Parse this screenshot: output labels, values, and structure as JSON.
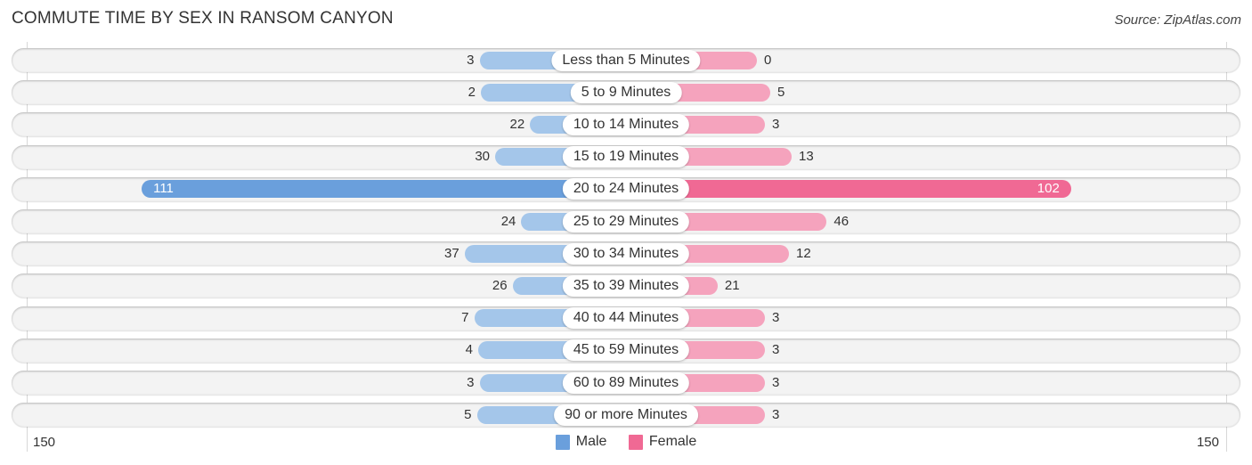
{
  "title": "COMMUTE TIME BY SEX IN RANSOM CANYON",
  "source": "Source: ZipAtlas.com",
  "chart_data": {
    "type": "bar",
    "orientation": "horizontal-diverging",
    "title": "COMMUTE TIME BY SEX IN RANSOM CANYON",
    "categories": [
      "Less than 5 Minutes",
      "5 to 9 Minutes",
      "10 to 14 Minutes",
      "15 to 19 Minutes",
      "20 to 24 Minutes",
      "25 to 29 Minutes",
      "30 to 34 Minutes",
      "35 to 39 Minutes",
      "40 to 44 Minutes",
      "45 to 59 Minutes",
      "60 to 89 Minutes",
      "90 or more Minutes"
    ],
    "series": [
      {
        "name": "Male",
        "color": "#6a9fdc",
        "light_color": "#a4c6ea",
        "values": [
          3,
          2,
          22,
          30,
          111,
          24,
          37,
          26,
          7,
          4,
          3,
          5
        ]
      },
      {
        "name": "Female",
        "color": "#f06994",
        "light_color": "#f5a3bd",
        "values": [
          0,
          5,
          3,
          13,
          102,
          46,
          12,
          21,
          3,
          3,
          3,
          3
        ]
      }
    ],
    "axis": {
      "left_label": "150",
      "right_label": "150",
      "max": 150
    },
    "legend": {
      "position": "bottom-center",
      "entries": [
        "Male",
        "Female"
      ]
    },
    "grid": false
  }
}
